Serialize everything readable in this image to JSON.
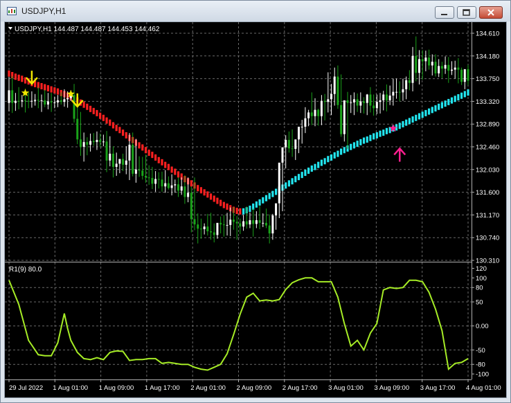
{
  "window": {
    "title": "USDJPY,H1",
    "controls": [
      "minimize",
      "maximize",
      "close"
    ],
    "icons": {
      "app": "chart-app-icon",
      "minimize": "minimize-icon",
      "maximize": "maximize-icon",
      "close": "close-icon"
    }
  },
  "main_chart": {
    "header": "USDJPY,H1  144.487 144.487 144.453 144.462",
    "price_ticks": [
      "134.610",
      "134.180",
      "133.750",
      "133.320",
      "132.890",
      "132.460",
      "132.030",
      "131.600",
      "131.170",
      "130.740",
      "130.310"
    ],
    "signals": [
      {
        "type": "sell-arrow",
        "x": 7.0,
        "price": 133.77
      },
      {
        "type": "star",
        "x": 5.0,
        "price": 133.48
      },
      {
        "type": "star",
        "x": 19.0,
        "price": 133.46
      },
      {
        "type": "sell-arrow",
        "x": 21.0,
        "price": 133.34
      },
      {
        "type": "star",
        "x": 118.0,
        "price": 132.81
      },
      {
        "type": "buy-arrow",
        "x": 120.0,
        "price": 132.31
      }
    ]
  },
  "sub_chart": {
    "header": "R1(9) 80.0",
    "ticks": [
      "120",
      "100",
      "80",
      "50",
      "0.00",
      "-50",
      "-80",
      "-100"
    ]
  },
  "time_axis": [
    "29 Jul 2022",
    "1 Aug 01:00",
    "1 Aug 09:00",
    "1 Aug 17:00",
    "2 Aug 01:00",
    "2 Aug 09:00",
    "2 Aug 17:00",
    "3 Aug 01:00",
    "3 Aug 09:00",
    "3 Aug 17:00",
    "4 Aug 01:00"
  ],
  "colors": {
    "background": "#000000",
    "grid": "#6a6a6a",
    "bull": "#ffffff",
    "bear": "#1aa31a",
    "trail_down": "#ff2020",
    "trail_up": "#22e6f0",
    "oscillator": "#a6ec26",
    "sell_signal": "#f2e600",
    "buy_signal": "#ff1f8f"
  },
  "chart_data": [
    {
      "type": "candlestick",
      "title": "USDJPY,H1",
      "ylim": [
        130.31,
        134.61
      ],
      "x": [
        0,
        1,
        2,
        3,
        4,
        5,
        6,
        7,
        8,
        9,
        10,
        11,
        12,
        13,
        14,
        15,
        16,
        17,
        18,
        19,
        20,
        21,
        22,
        23,
        24,
        25,
        26,
        27,
        28,
        29,
        30,
        31,
        32,
        33,
        34,
        35,
        36,
        37,
        38,
        39,
        40,
        41,
        42,
        43,
        44,
        45,
        46,
        47,
        48,
        49,
        50,
        51,
        52,
        53,
        54,
        55,
        56,
        57,
        58,
        59,
        60,
        61,
        62,
        63,
        64,
        65,
        66,
        67,
        68,
        69,
        70,
        71,
        72,
        73,
        74,
        75,
        76,
        77,
        78,
        79,
        80,
        81,
        82,
        83,
        84,
        85,
        86,
        87,
        88,
        89,
        90,
        91,
        92,
        93,
        94,
        95,
        96,
        97,
        98,
        99,
        100,
        101,
        102,
        103,
        104,
        105,
        106,
        107,
        108,
        109,
        110,
        111,
        112,
        113,
        114,
        115,
        116,
        117,
        118,
        119,
        120,
        121,
        122,
        123,
        124,
        125,
        126,
        127,
        128,
        129,
        130,
        131,
        132,
        133,
        134,
        135,
        136,
        137,
        138,
        139,
        140,
        141
      ],
      "open": [
        133.29,
        133.53,
        133.29,
        133.33,
        133.32,
        133.34,
        133.33,
        133.32,
        133.33,
        133.35,
        133.34,
        133.34,
        133.26,
        133.32,
        133.3,
        133.3,
        133.34,
        133.31,
        133.36,
        133.38,
        133.44,
        132.99,
        132.6,
        132.46,
        132.55,
        132.5,
        132.57,
        132.55,
        132.59,
        132.55,
        132.56,
        132.2,
        132.33,
        132.08,
        132.14,
        132.23,
        132.12,
        132.2,
        132.5,
        131.95,
        132.03,
        132.01,
        131.91,
        131.88,
        131.87,
        131.76,
        131.85,
        131.84,
        131.71,
        131.77,
        131.68,
        131.73,
        131.75,
        131.63,
        131.71,
        131.51,
        131.59,
        131.09,
        130.99,
        130.91,
        130.9,
        130.95,
        130.86,
        130.84,
        130.79,
        131.02,
        130.99,
        130.98,
        130.98,
        131.08,
        131.04,
        131.01,
        130.95,
        131.05,
        130.99,
        131.07,
        131.0,
        131.07,
        131.02,
        131.02,
        130.97,
        130.82,
        131.16,
        131.39,
        132.16,
        132.45,
        132.59,
        132.43,
        132.42,
        132.6,
        132.84,
        132.84,
        133.0,
        133.11,
        133.04,
        133.16,
        133.04,
        133.33,
        133.31,
        133.36,
        133.46,
        133.79,
        133.25,
        132.7,
        133.34,
        133.29,
        133.3,
        133.36,
        133.24,
        133.32,
        133.29,
        133.45,
        133.24,
        133.19,
        133.31,
        133.34,
        133.45,
        133.34,
        133.43,
        133.5,
        133.5,
        133.49,
        133.55,
        133.72,
        133.67,
        134.18,
        133.86,
        134.12,
        134.08,
        134.15,
        134.0,
        134.07,
        133.85,
        133.99,
        133.94,
        134.01,
        133.9,
        133.92,
        133.96,
        133.92,
        133.69,
        133.93
      ],
      "high": [
        133.78,
        133.8,
        133.48,
        133.59,
        133.44,
        133.56,
        133.49,
        133.51,
        133.46,
        133.59,
        133.45,
        133.54,
        133.48,
        133.48,
        133.41,
        133.44,
        133.49,
        133.55,
        133.51,
        133.53,
        133.65,
        133.33,
        133.12,
        132.73,
        132.64,
        132.71,
        132.72,
        132.75,
        132.71,
        132.69,
        132.76,
        132.66,
        132.47,
        132.35,
        132.23,
        132.33,
        132.47,
        132.72,
        132.73,
        132.61,
        132.28,
        132.27,
        132.31,
        132.11,
        132.08,
        132.0,
        131.98,
        131.99,
        132.02,
        131.9,
        131.94,
        131.84,
        131.88,
        131.88,
        131.92,
        131.88,
        131.71,
        131.88,
        131.2,
        131.1,
        131.01,
        131.19,
        131.21,
        131.01,
        131.0,
        131.14,
        131.17,
        131.21,
        131.31,
        131.32,
        131.15,
        131.1,
        131.17,
        131.33,
        131.22,
        131.29,
        131.24,
        131.34,
        131.2,
        131.29,
        131.18,
        131.19,
        131.29,
        131.54,
        132.4,
        132.68,
        132.75,
        132.79,
        132.58,
        132.79,
        132.97,
        133.21,
        133.16,
        133.49,
        133.38,
        133.18,
        133.44,
        133.46,
        133.87,
        133.65,
        133.96,
        134.0,
        133.83,
        133.2,
        133.5,
        133.44,
        133.49,
        133.47,
        133.49,
        133.4,
        133.46,
        133.59,
        133.45,
        133.45,
        133.48,
        133.52,
        133.64,
        133.62,
        133.75,
        133.75,
        133.7,
        133.75,
        133.79,
        133.91,
        134.35,
        134.55,
        134.29,
        134.29,
        134.28,
        134.3,
        134.21,
        134.21,
        134.12,
        134.07,
        134.17,
        134.16,
        134.08,
        134.09,
        134.14,
        133.96,
        133.92,
        134.01
      ],
      "low": [
        133.13,
        133.1,
        133.14,
        133.17,
        133.21,
        133.11,
        133.19,
        133.2,
        133.24,
        133.19,
        133.12,
        133.21,
        133.17,
        133.12,
        133.19,
        133.21,
        133.26,
        133.22,
        133.2,
        133.33,
        132.92,
        132.51,
        132.29,
        132.18,
        132.3,
        132.37,
        132.48,
        132.4,
        132.45,
        132.47,
        131.98,
        132.09,
        131.88,
        131.91,
        131.96,
        132.0,
        131.94,
        131.83,
        131.9,
        131.78,
        131.89,
        131.84,
        131.78,
        131.74,
        131.66,
        131.61,
        131.67,
        131.61,
        131.59,
        131.65,
        131.54,
        131.59,
        131.51,
        131.55,
        131.38,
        131.41,
        130.84,
        130.88,
        130.63,
        130.72,
        130.8,
        130.78,
        130.7,
        130.65,
        130.72,
        130.82,
        130.76,
        130.78,
        130.77,
        130.89,
        130.7,
        130.81,
        130.87,
        130.91,
        130.92,
        130.76,
        130.92,
        130.9,
        130.94,
        130.92,
        130.63,
        130.7,
        130.89,
        131.11,
        131.24,
        132.05,
        132.35,
        132.27,
        132.21,
        132.34,
        132.52,
        132.72,
        132.85,
        132.87,
        132.85,
        132.86,
        132.87,
        132.96,
        133.11,
        133.06,
        133.24,
        133.18,
        132.65,
        132.56,
        132.42,
        133.1,
        133.06,
        133.12,
        133.1,
        133.09,
        133.06,
        133.11,
        133.05,
        133.08,
        133.09,
        133.15,
        133.13,
        133.25,
        133.24,
        133.37,
        133.32,
        133.33,
        133.36,
        133.53,
        133.51,
        133.7,
        133.64,
        133.73,
        133.89,
        133.92,
        133.81,
        133.79,
        133.78,
        133.76,
        133.84,
        133.67,
        133.82,
        133.75,
        133.66,
        133.63,
        133.55,
        133.63
      ],
      "close": [
        133.53,
        133.29,
        133.33,
        133.32,
        133.34,
        133.33,
        133.32,
        133.33,
        133.35,
        133.34,
        133.34,
        133.26,
        133.32,
        133.3,
        133.3,
        133.34,
        133.31,
        133.36,
        133.38,
        133.44,
        132.99,
        132.6,
        132.46,
        132.55,
        132.5,
        132.57,
        132.55,
        132.59,
        132.55,
        132.56,
        132.2,
        132.33,
        132.08,
        132.14,
        132.23,
        132.12,
        132.2,
        132.5,
        131.95,
        132.03,
        132.01,
        131.91,
        131.88,
        131.87,
        131.76,
        131.85,
        131.84,
        131.71,
        131.77,
        131.68,
        131.73,
        131.75,
        131.63,
        131.71,
        131.51,
        131.59,
        131.09,
        130.99,
        130.91,
        130.9,
        130.95,
        130.86,
        130.84,
        130.79,
        131.02,
        130.99,
        130.98,
        130.98,
        131.08,
        131.04,
        131.01,
        130.95,
        131.05,
        130.99,
        131.07,
        131.0,
        131.07,
        131.02,
        131.02,
        130.97,
        130.82,
        131.16,
        131.39,
        132.16,
        132.45,
        132.59,
        132.43,
        132.42,
        132.6,
        132.84,
        132.84,
        133.0,
        133.11,
        133.04,
        133.16,
        133.04,
        133.33,
        133.31,
        133.36,
        133.46,
        133.79,
        133.25,
        132.7,
        133.34,
        133.29,
        133.3,
        133.36,
        133.24,
        133.32,
        133.29,
        133.45,
        133.24,
        133.19,
        133.31,
        133.34,
        133.45,
        133.34,
        133.43,
        133.5,
        133.5,
        133.49,
        133.55,
        133.72,
        133.67,
        134.18,
        133.86,
        134.12,
        134.08,
        134.15,
        134.0,
        134.07,
        133.85,
        133.99,
        133.94,
        134.01,
        133.9,
        133.92,
        133.96,
        133.92,
        133.69,
        133.93,
        133.71
      ],
      "series": [
        {
          "style": "down-trail",
          "x_start": 0,
          "values": [
            133.88,
            133.85,
            133.82,
            133.8,
            133.78,
            133.75,
            133.73,
            133.7,
            133.68,
            133.66,
            133.64,
            133.62,
            133.6,
            133.58,
            133.56,
            133.54,
            133.51,
            133.49,
            133.46,
            133.43,
            133.4,
            133.37,
            133.33,
            133.29,
            133.25,
            133.21,
            133.17,
            133.13,
            133.08,
            133.04,
            132.99,
            132.95,
            132.9,
            132.85,
            132.81,
            132.76,
            132.71,
            132.66,
            132.62,
            132.57,
            132.52,
            132.48,
            132.43,
            132.38,
            132.34,
            132.29,
            132.24,
            132.2,
            132.15,
            132.11,
            132.06,
            132.02,
            131.97,
            131.93,
            131.88,
            131.84,
            131.8,
            131.76,
            131.71,
            131.67,
            131.63,
            131.59,
            131.55,
            131.51,
            131.47,
            131.43,
            131.39,
            131.36,
            131.33,
            131.3,
            131.28,
            131.27
          ]
        },
        {
          "style": "up-trail",
          "x_start": 72,
          "values": [
            131.27,
            131.29,
            131.32,
            131.36,
            131.4,
            131.44,
            131.48,
            131.52,
            131.56,
            131.6,
            131.64,
            131.68,
            131.72,
            131.76,
            131.8,
            131.84,
            131.88,
            131.92,
            131.96,
            132.0,
            132.04,
            132.08,
            132.11,
            132.15,
            132.19,
            132.22,
            132.26,
            132.29,
            132.33,
            132.36,
            132.4,
            132.43,
            132.46,
            132.49,
            132.52,
            132.55,
            132.58,
            132.61,
            132.63,
            132.66,
            132.69,
            132.71,
            132.74,
            132.76,
            132.79,
            132.81,
            132.84,
            132.86,
            132.89,
            132.92,
            132.95,
            132.98,
            133.01,
            133.04,
            133.07,
            133.1,
            133.13,
            133.16,
            133.19,
            133.22,
            133.25,
            133.28,
            133.31,
            133.34,
            133.37,
            133.4,
            133.43,
            133.46,
            133.49,
            133.52
          ]
        }
      ]
    },
    {
      "type": "line",
      "title": "R1(9) 80.0",
      "ylim": [
        -110,
        125
      ],
      "series": [
        {
          "name": "R1(9)",
          "x": [
            0,
            3,
            6,
            9,
            11,
            13,
            15,
            17,
            18,
            19,
            21,
            23,
            25,
            27,
            29,
            31,
            33,
            35,
            37,
            39,
            41,
            43,
            45,
            47,
            49,
            51,
            53,
            55,
            57,
            59,
            61,
            63,
            65,
            67,
            69,
            71,
            73,
            75,
            77,
            79,
            81,
            83,
            85,
            87,
            89,
            91,
            93,
            95,
            97,
            99,
            101,
            103,
            105,
            107,
            109,
            111,
            113,
            115,
            117,
            119,
            121,
            123,
            125,
            127,
            129,
            131,
            133,
            135,
            137,
            139,
            141
          ],
          "values": [
            95,
            45,
            -30,
            -60,
            -62,
            -62,
            -35,
            26,
            -5,
            -30,
            -55,
            -68,
            -70,
            -66,
            -70,
            -55,
            -52,
            -53,
            -72,
            -70,
            -70,
            -68,
            -68,
            -78,
            -76,
            -78,
            -80,
            -80,
            -86,
            -90,
            -92,
            -86,
            -80,
            -58,
            -18,
            25,
            60,
            68,
            52,
            54,
            52,
            55,
            76,
            90,
            96,
            100,
            100,
            92,
            92,
            92,
            60,
            5,
            -42,
            -30,
            -50,
            -15,
            5,
            75,
            80,
            78,
            80,
            95,
            95,
            92,
            70,
            35,
            -10,
            -90,
            -78,
            -76,
            -68
          ]
        }
      ],
      "reference_lines": [
        80,
        50,
        0,
        -50,
        -80
      ]
    }
  ]
}
